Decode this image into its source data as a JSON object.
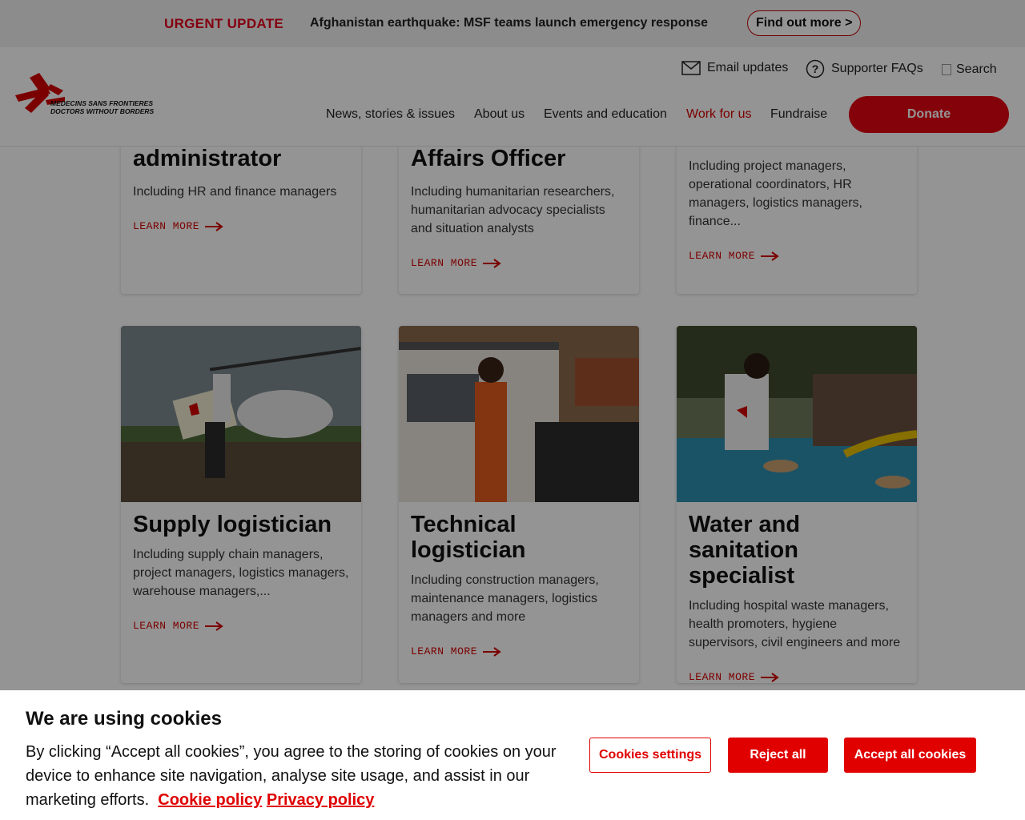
{
  "alert": {
    "label": "URGENT UPDATE",
    "headline": "Afghanistan earthquake: MSF teams launch emergency response",
    "cta": "Find out more >"
  },
  "header": {
    "logo_line1": "MEDECINS SANS FRONTIERES",
    "logo_line2": "DOCTORS WITHOUT BORDERS",
    "utility": {
      "email": "Email updates",
      "faqs": "Supporter FAQs",
      "search": "Search"
    },
    "nav": [
      "News, stories & issues",
      "About us",
      "Events and education",
      "Work for us",
      "Fundraise"
    ],
    "donate": "Donate"
  },
  "cards_top": [
    {
      "title": "administrator",
      "desc": "Including HR and finance managers",
      "cta": "LEARN MORE"
    },
    {
      "title": "Affairs Officer",
      "desc": "Including humanitarian researchers, humanitarian advocacy specialists and situation analysts",
      "cta": "LEARN MORE"
    },
    {
      "title": "y",
      "desc": "Including project managers, operational coordinators, HR managers, logistics managers, finance...",
      "cta": "LEARN MORE"
    }
  ],
  "cards": [
    {
      "title": "Supply logistician",
      "desc": "Including supply chain managers, project managers, logistics managers, warehouse managers,...",
      "cta": "LEARN MORE"
    },
    {
      "title": "Technical logistician",
      "desc": "Including construction managers, maintenance managers, logistics managers and more",
      "cta": "LEARN MORE"
    },
    {
      "title": "Water and sanitation specialist",
      "desc": "Including hospital waste managers, health promoters, hygiene supervisors, civil engineers and more",
      "cta": "LEARN MORE"
    }
  ],
  "cookie": {
    "title": "We are using cookies",
    "text": "By clicking “Accept all cookies”, you agree to the storing of cookies on your device to enhance site navigation, analyse site usage, and assist in our marketing efforts.",
    "cookie_policy": "Cookie policy",
    "privacy_policy": "Privacy policy",
    "settings": "Cookies settings",
    "reject": "Reject all",
    "accept": "Accept all cookies"
  },
  "colors": {
    "brand_red": "#e30613",
    "link_red": "#d40000"
  }
}
